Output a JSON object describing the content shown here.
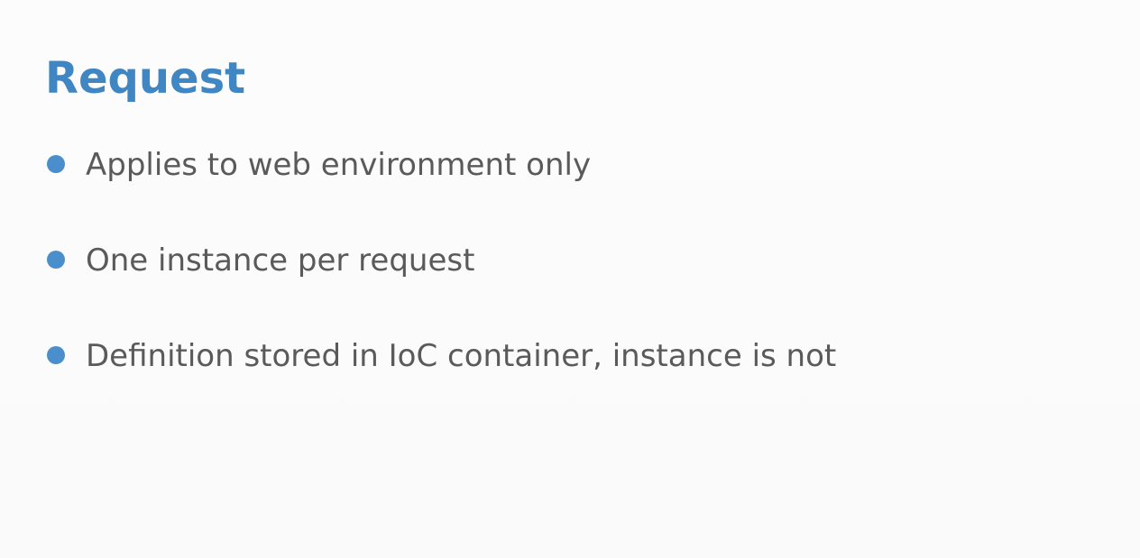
{
  "slide": {
    "title": "Request",
    "bullets": [
      {
        "text": "Applies to web environment only"
      },
      {
        "text": "One instance per request"
      },
      {
        "text": "Definition stored in IoC container, instance is not"
      }
    ]
  },
  "colors": {
    "title": "#3f86c2",
    "bullet_dot": "#4a8fcb",
    "body_text": "#5a5a5a",
    "background": "#fbfbfb"
  }
}
